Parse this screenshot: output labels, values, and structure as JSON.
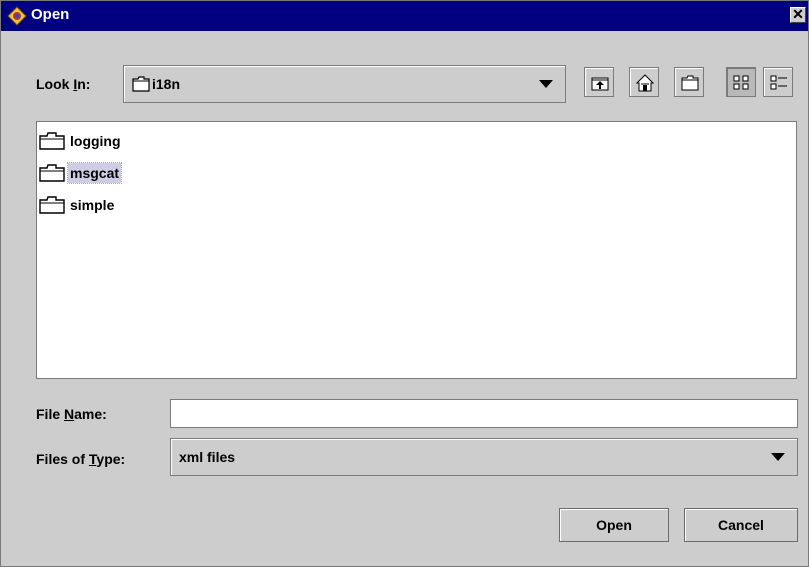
{
  "window": {
    "title": "Open",
    "close_glyph": "✕"
  },
  "look_in": {
    "label_before": "Look ",
    "label_mnemonic": "I",
    "label_after": "n:",
    "value": "i18n"
  },
  "toolbar": {
    "up_folder": "up-folder-icon",
    "home": "home-icon",
    "new_folder": "new-folder-icon",
    "list_view": "list-view-icon",
    "details_view": "details-view-icon"
  },
  "files": [
    {
      "name": "logging",
      "selected": false
    },
    {
      "name": "msgcat",
      "selected": true
    },
    {
      "name": "simple",
      "selected": false
    }
  ],
  "file_name": {
    "label_before": "File ",
    "label_mnemonic": "N",
    "label_after": "ame:",
    "value": ""
  },
  "file_type": {
    "label_before": "Files of ",
    "label_mnemonic": "T",
    "label_after": "ype:",
    "value": "xml files"
  },
  "buttons": {
    "open": "Open",
    "cancel": "Cancel"
  }
}
